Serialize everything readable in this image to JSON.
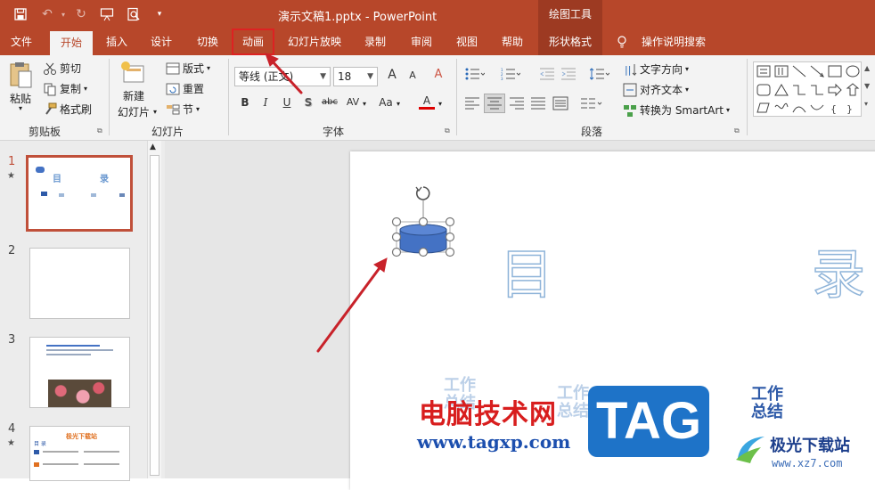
{
  "window": {
    "title": "演示文稿1.pptx  -  PowerPoint",
    "context_group": "绘图工具"
  },
  "tabs": [
    {
      "label": "文件"
    },
    {
      "label": "开始",
      "active": true
    },
    {
      "label": "插入"
    },
    {
      "label": "设计"
    },
    {
      "label": "切换"
    },
    {
      "label": "动画",
      "highlighted": true
    },
    {
      "label": "幻灯片放映"
    },
    {
      "label": "录制"
    },
    {
      "label": "审阅"
    },
    {
      "label": "视图"
    },
    {
      "label": "帮助"
    },
    {
      "label": "形状格式"
    }
  ],
  "tell_me": "操作说明搜索",
  "ribbon": {
    "clipboard": {
      "paste": "粘贴",
      "cut": "剪切",
      "copy": "复制",
      "format_painter": "格式刷",
      "label": "剪贴板"
    },
    "slides": {
      "new_slide_line1": "新建",
      "new_slide_line2": "幻灯片",
      "layout": "版式",
      "reset": "重置",
      "section": "节",
      "label": "幻灯片"
    },
    "font": {
      "font_name": "等线 (正文)",
      "font_size": "18",
      "grow": "A",
      "shrink": "A",
      "clear": "A",
      "bold": "B",
      "italic": "I",
      "underline": "U",
      "shadow": "S",
      "strike": "abc",
      "spacing": "AV",
      "case": "Aa",
      "color": "A",
      "label": "字体"
    },
    "paragraph": {
      "text_direction": "文字方向",
      "align_text": "对齐文本",
      "smartart": "转换为 SmartArt",
      "label": "段落"
    }
  },
  "slides_panel": [
    {
      "number": "1",
      "star": "★",
      "selected": true,
      "title_a": "目",
      "title_b": "录"
    },
    {
      "number": "2",
      "star": ""
    },
    {
      "number": "3",
      "star": ""
    },
    {
      "number": "4",
      "star": "★",
      "heading": "极光下载站",
      "heading2": "目 录"
    }
  ],
  "slide": {
    "char_left": "目",
    "char_right": "录",
    "labels": [
      "工作",
      "总结"
    ]
  },
  "watermarks": {
    "cn_site": "电脑技术网",
    "url": "www.tagxp.com",
    "tag": "TAG",
    "site_name": "极光下载站",
    "site_url": "www.xz7.com"
  },
  "colors": {
    "brand": "#b7472a",
    "shape_fill": "#4472c4",
    "arrow": "#c8222a"
  }
}
